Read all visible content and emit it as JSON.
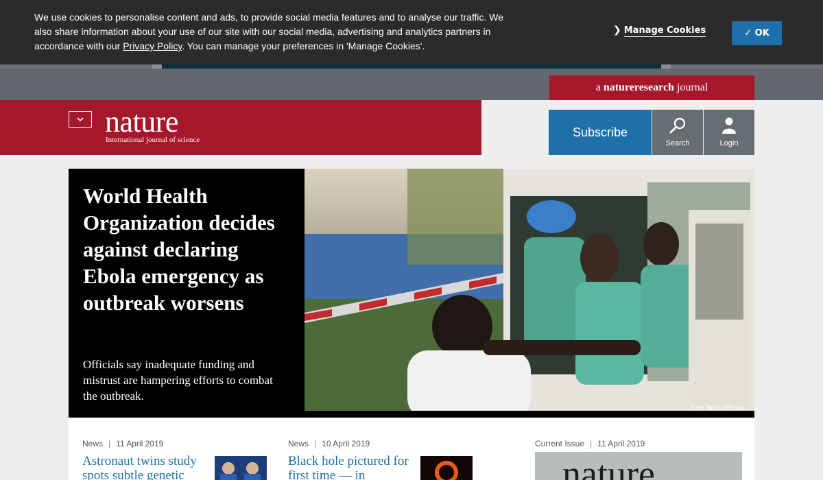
{
  "cookie_banner": {
    "text_before": "We use cookies to personalise content and ads, to provide social media features and to analyse our traffic. We also share information about your use of our site with our social media, advertising and analytics partners in accordance with our ",
    "privacy_link": "Privacy Policy",
    "text_after": ". You can manage your preferences in 'Manage Cookies'.",
    "manage_label": "Manage Cookies",
    "ok_label": "✓ OK"
  },
  "badge": {
    "prefix": "a ",
    "brand": "natureresearch",
    "suffix": " journal"
  },
  "header": {
    "logo": "nature",
    "tagline": "International journal of science",
    "subscribe_label": "Subscribe",
    "search_label": "Search",
    "login_label": "Login"
  },
  "hero": {
    "title": "World Health Organization decides against declaring Ebola emergency as outbreak worsens",
    "summary": "Officials say inadequate funding and mistrust are hampering efforts to combat the outbreak.",
    "credit": "Sven Torfinn/Panos"
  },
  "cards": [
    {
      "type": "News",
      "date": "11 April 2019",
      "title": "Astronaut twins study spots subtle genetic"
    },
    {
      "type": "News",
      "date": "10 April 2019",
      "title": "Black hole pictured for first time — in"
    }
  ],
  "current_issue": {
    "label": "Current Issue",
    "date": "11 April 2019",
    "cover_title": "nature"
  },
  "colors": {
    "brand_red": "#a5172b",
    "accent_blue": "#1f6fa8",
    "banner_bg": "#2b2b2b"
  }
}
